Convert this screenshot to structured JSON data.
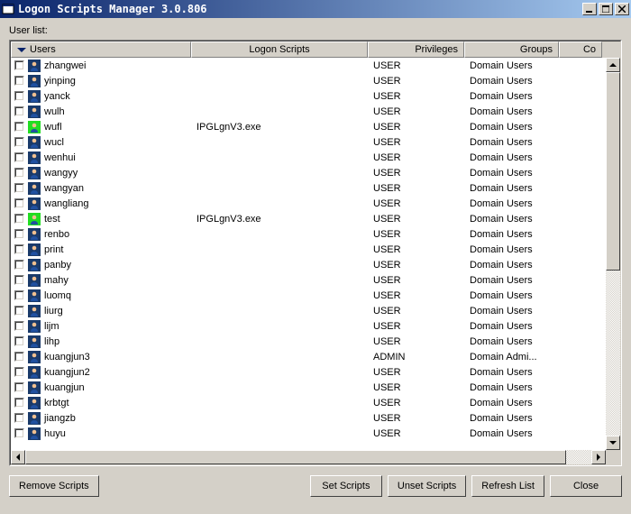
{
  "window": {
    "title": "Logon Scripts Manager 3.0.806"
  },
  "labels": {
    "userlist": "User list:"
  },
  "columns": {
    "users": "Users",
    "scripts": "Logon Scripts",
    "privileges": "Privileges",
    "groups": "Groups",
    "co": "Co"
  },
  "buttons": {
    "remove": "Remove Scripts",
    "set": "Set Scripts",
    "unset": "Unset Scripts",
    "refresh": "Refresh List",
    "close": "Close"
  },
  "rows": [
    {
      "user": "zhangwei",
      "script": "",
      "priv": "USER",
      "group": "Domain Users",
      "highlight": false
    },
    {
      "user": "yinping",
      "script": "",
      "priv": "USER",
      "group": "Domain Users",
      "highlight": false
    },
    {
      "user": "yanck",
      "script": "",
      "priv": "USER",
      "group": "Domain Users",
      "highlight": false
    },
    {
      "user": "wulh",
      "script": "",
      "priv": "USER",
      "group": "Domain Users",
      "highlight": false
    },
    {
      "user": "wufl",
      "script": "IPGLgnV3.exe",
      "priv": "USER",
      "group": "Domain Users",
      "highlight": true
    },
    {
      "user": "wucl",
      "script": "",
      "priv": "USER",
      "group": "Domain Users",
      "highlight": false
    },
    {
      "user": "wenhui",
      "script": "",
      "priv": "USER",
      "group": "Domain Users",
      "highlight": false
    },
    {
      "user": "wangyy",
      "script": "",
      "priv": "USER",
      "group": "Domain Users",
      "highlight": false
    },
    {
      "user": "wangyan",
      "script": "",
      "priv": "USER",
      "group": "Domain Users",
      "highlight": false
    },
    {
      "user": "wangliang",
      "script": "",
      "priv": "USER",
      "group": "Domain Users",
      "highlight": false
    },
    {
      "user": "test",
      "script": "IPGLgnV3.exe",
      "priv": "USER",
      "group": "Domain Users",
      "highlight": true
    },
    {
      "user": "renbo",
      "script": "",
      "priv": "USER",
      "group": "Domain Users",
      "highlight": false
    },
    {
      "user": "print",
      "script": "",
      "priv": "USER",
      "group": "Domain Users",
      "highlight": false
    },
    {
      "user": "panby",
      "script": "",
      "priv": "USER",
      "group": "Domain Users",
      "highlight": false
    },
    {
      "user": "mahy",
      "script": "",
      "priv": "USER",
      "group": "Domain Users",
      "highlight": false
    },
    {
      "user": "luomq",
      "script": "",
      "priv": "USER",
      "group": "Domain Users",
      "highlight": false
    },
    {
      "user": "liurg",
      "script": "",
      "priv": "USER",
      "group": "Domain Users",
      "highlight": false
    },
    {
      "user": "lijm",
      "script": "",
      "priv": "USER",
      "group": "Domain Users",
      "highlight": false
    },
    {
      "user": "lihp",
      "script": "",
      "priv": "USER",
      "group": "Domain Users",
      "highlight": false
    },
    {
      "user": "kuangjun3",
      "script": "",
      "priv": "ADMIN",
      "group": "Domain Admi...",
      "highlight": false
    },
    {
      "user": "kuangjun2",
      "script": "",
      "priv": "USER",
      "group": "Domain Users",
      "highlight": false
    },
    {
      "user": "kuangjun",
      "script": "",
      "priv": "USER",
      "group": "Domain Users",
      "highlight": false
    },
    {
      "user": "krbtgt",
      "script": "",
      "priv": "USER",
      "group": "Domain Users",
      "highlight": false
    },
    {
      "user": "jiangzb",
      "script": "",
      "priv": "USER",
      "group": "Domain Users",
      "highlight": false
    },
    {
      "user": "huyu",
      "script": "",
      "priv": "USER",
      "group": "Domain Users",
      "highlight": false
    }
  ]
}
